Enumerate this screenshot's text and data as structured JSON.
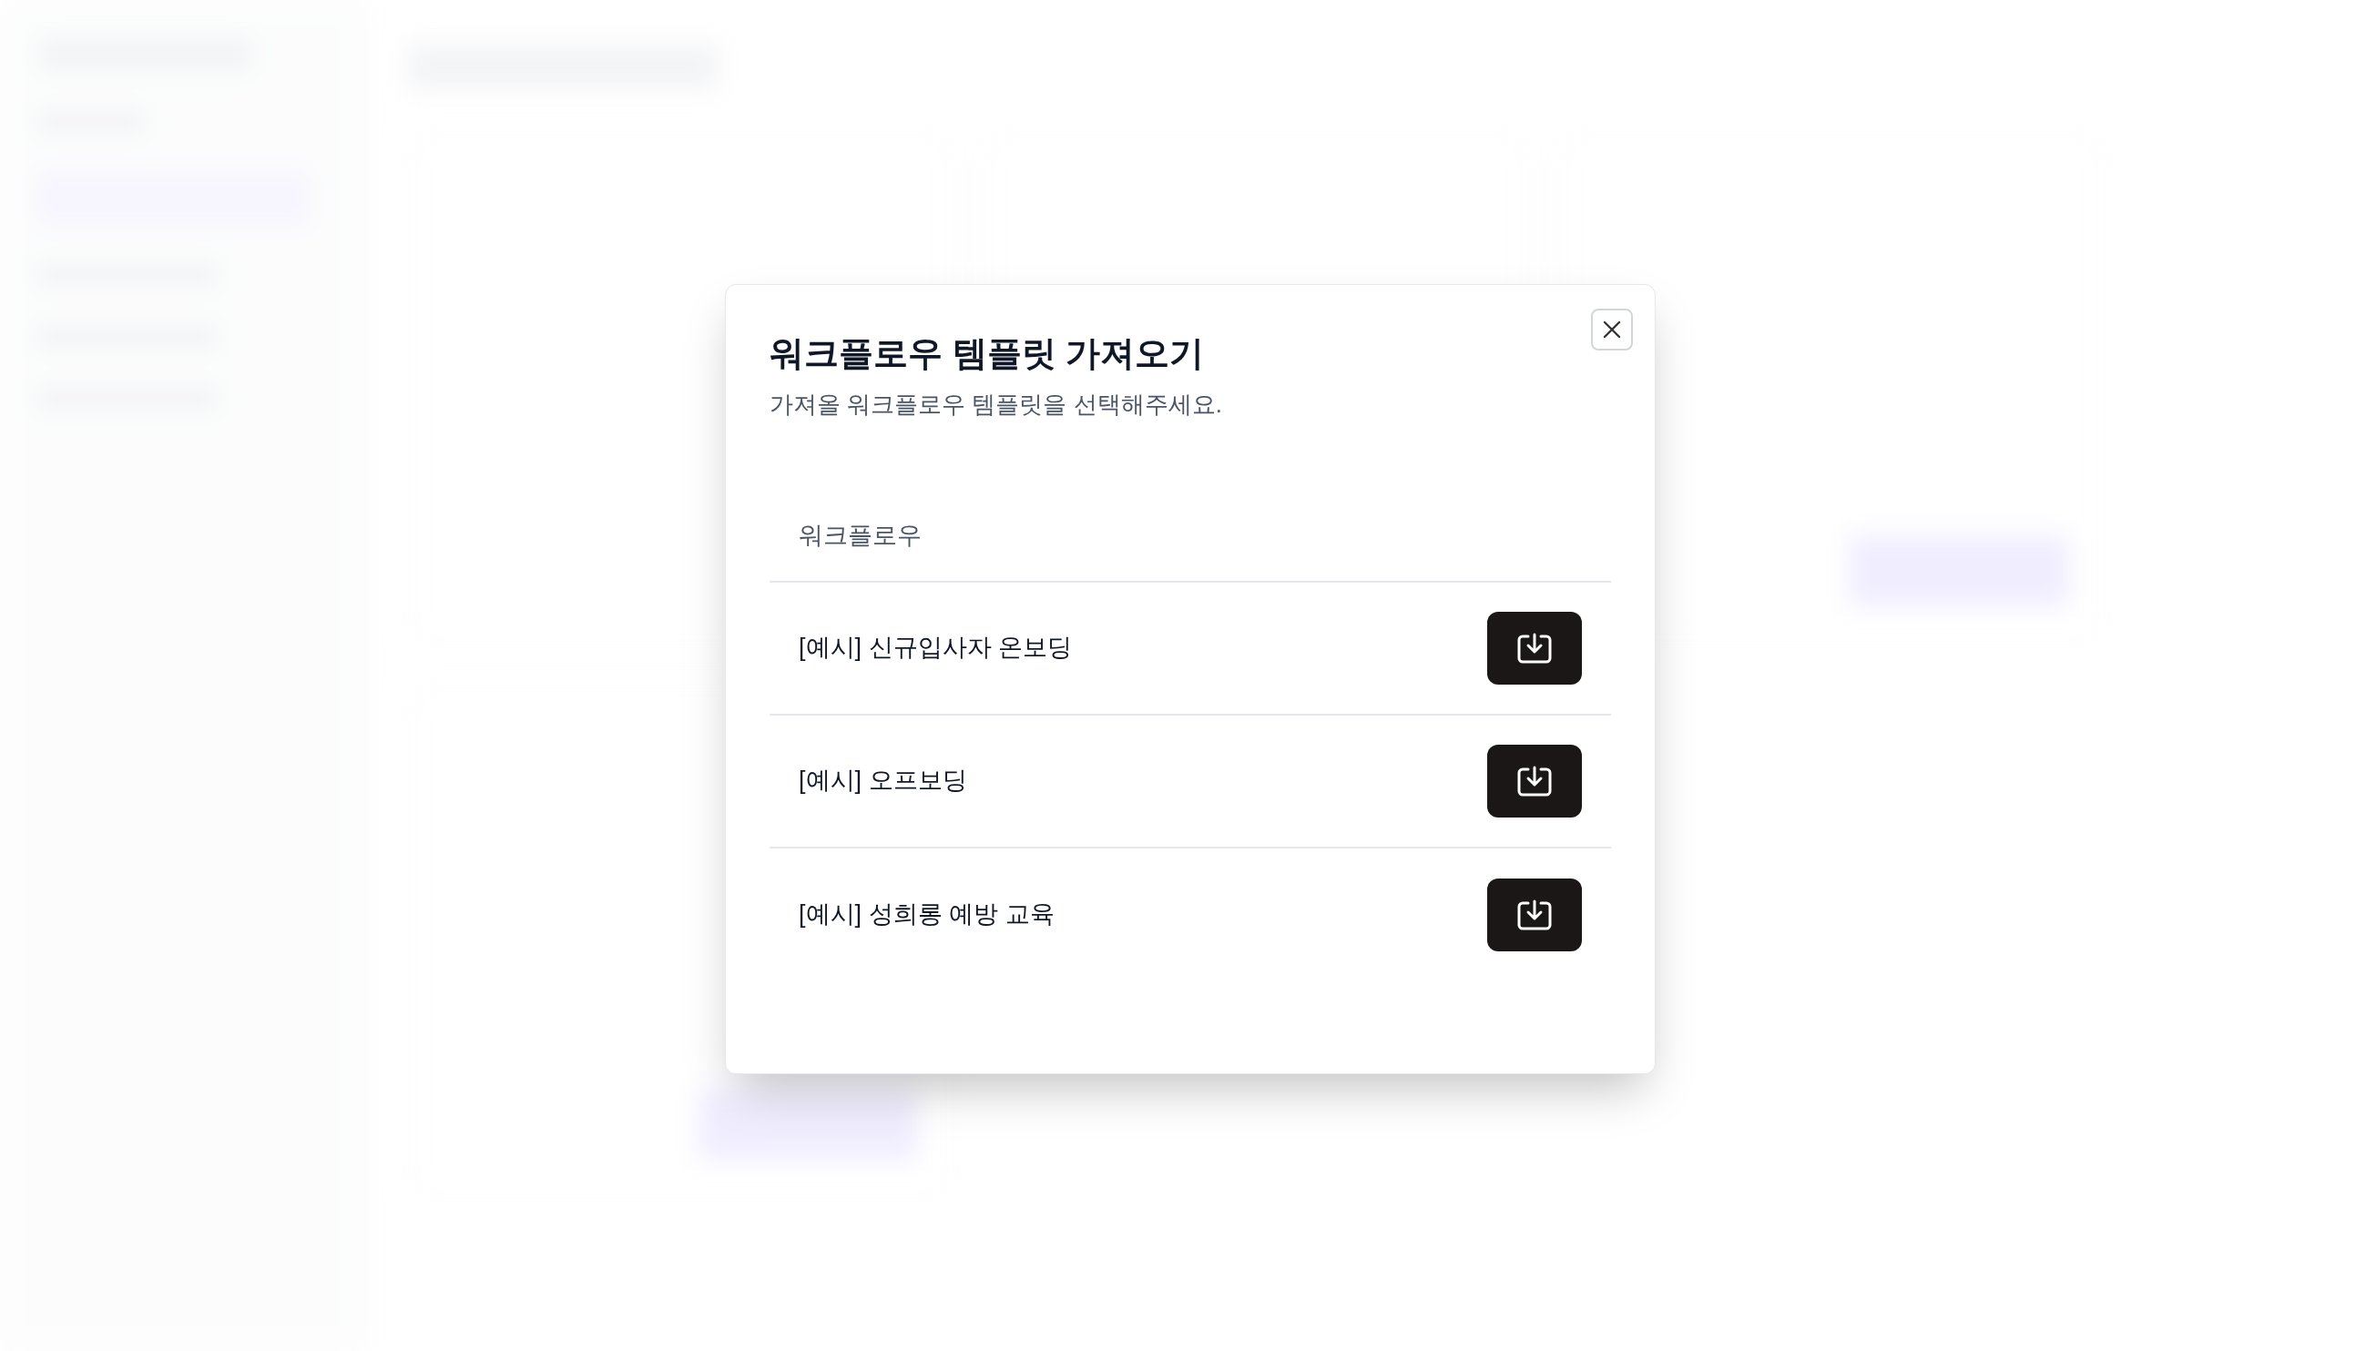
{
  "dialog": {
    "title": "워크플로우 템플릿 가져오기",
    "subtitle": "가져올 워크플로우 템플릿을 선택해주세요.",
    "table": {
      "columns": [
        "워크플로우"
      ],
      "rows": [
        {
          "name": "[예시] 신규입사자 온보딩"
        },
        {
          "name": "[예시] 오프보딩"
        },
        {
          "name": "[예시] 성희롱 예방 교육"
        }
      ]
    }
  }
}
